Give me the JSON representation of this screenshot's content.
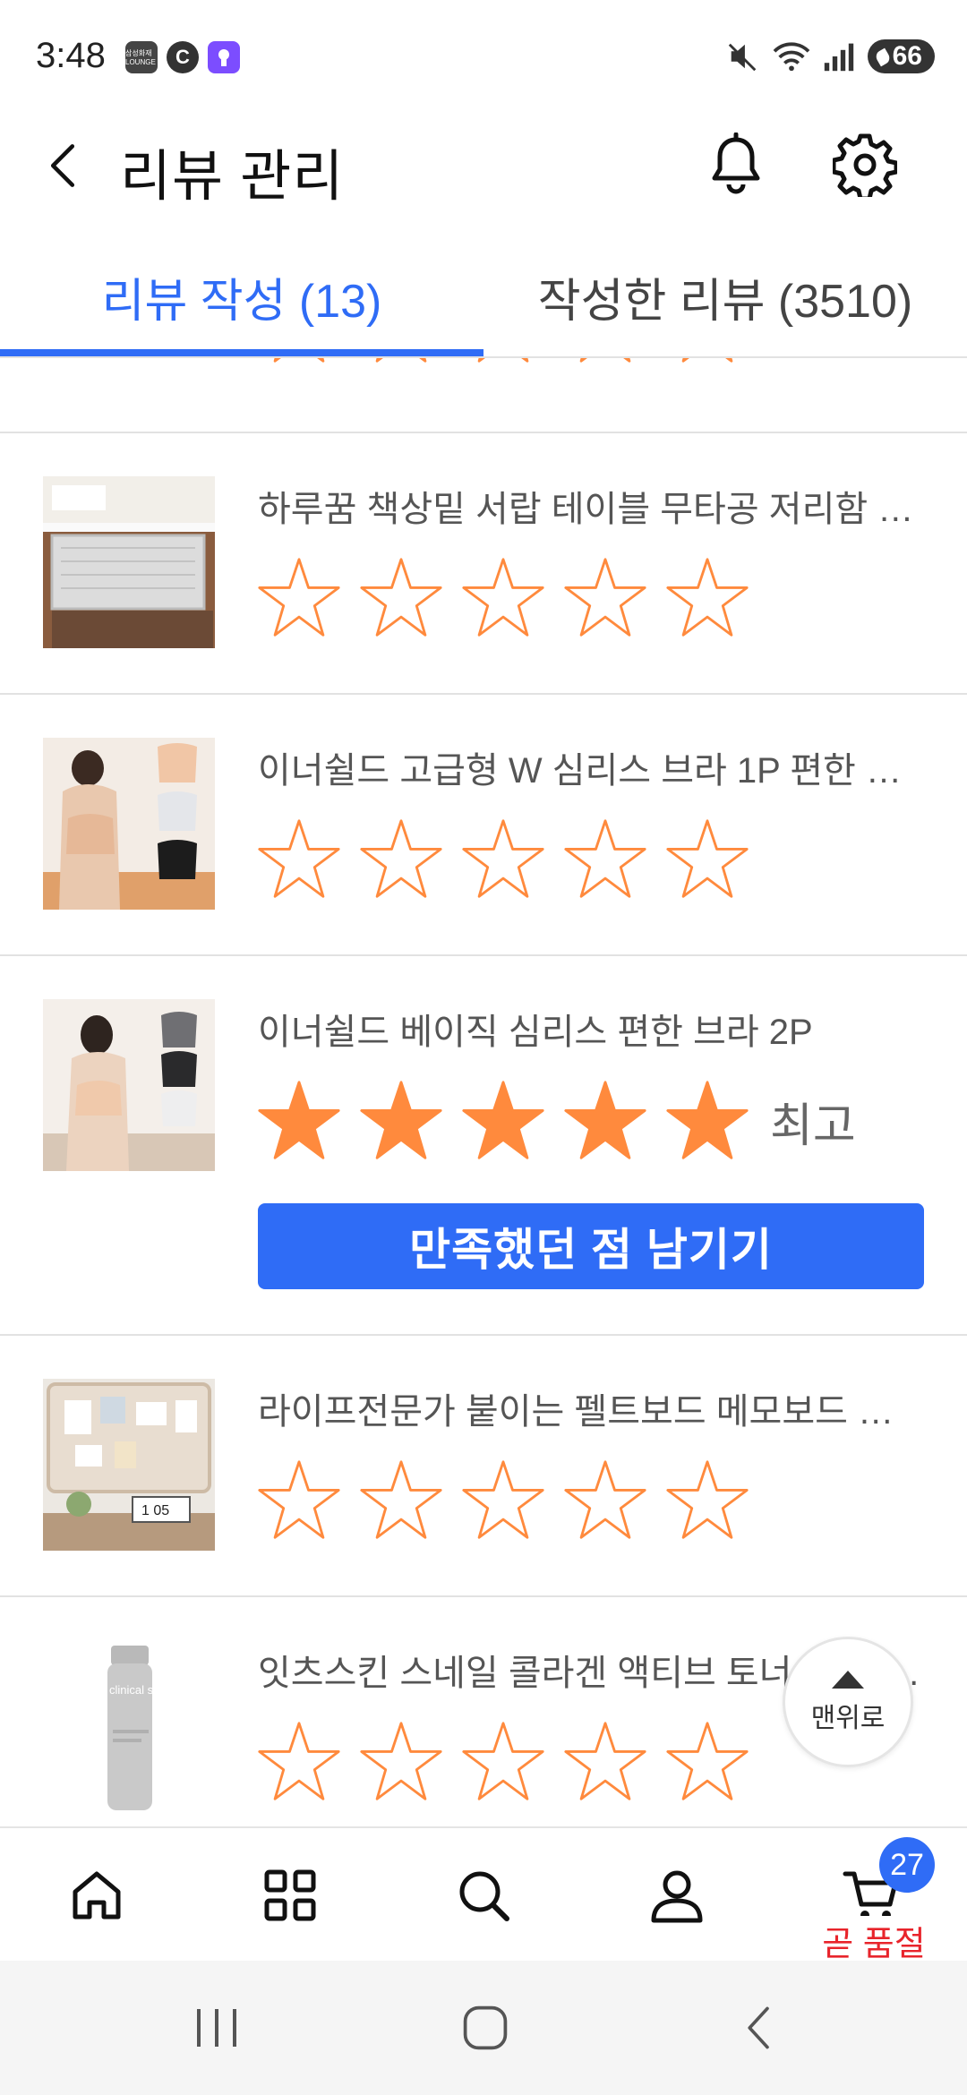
{
  "status_bar": {
    "time": "3:48",
    "battery": "66",
    "lounge_label": "삼성화재 LOUNGE",
    "c_label": "C"
  },
  "header": {
    "title": "리뷰 관리"
  },
  "tabs": [
    {
      "label": "리뷰 작성 (13)",
      "active": true
    },
    {
      "label": "작성한 리뷰 (3510)",
      "active": false
    }
  ],
  "items": [
    {
      "name": "하루꿈 책상밑 서랍 테이블 무타공 저리함 슬...",
      "rating": 0,
      "rating_label": ""
    },
    {
      "name": "이너쉴드 고급형 W 심리스 브라 1P 편한 브...",
      "rating": 0,
      "rating_label": ""
    },
    {
      "name": "이너쉴드 베이직 심리스 편한 브라 2P",
      "rating": 5,
      "rating_label": "최고",
      "cta": "만족했던 점 남기기"
    },
    {
      "name": "라이프전문가 붙이는 펠트보드 메모보드 인...",
      "rating": 0,
      "rating_label": ""
    },
    {
      "name": "잇츠스킨 스네일 콜라겐 액티브 토너, 1개, 1...",
      "rating": 0,
      "rating_label": ""
    }
  ],
  "thumb_text": {
    "clock_digits": "1 05",
    "bottle_text": "clinical solution It's skin"
  },
  "scroll_top": {
    "label": "맨위로"
  },
  "bottom_nav": {
    "items": [
      "home-icon",
      "category-icon",
      "search-icon",
      "profile-icon",
      "cart-icon"
    ],
    "cart_badge": "27",
    "cart_label": "곧 품절"
  },
  "colors": {
    "accent": "#2f6cf6",
    "star": "#ff8a3d",
    "soldout": "#e8242b"
  }
}
